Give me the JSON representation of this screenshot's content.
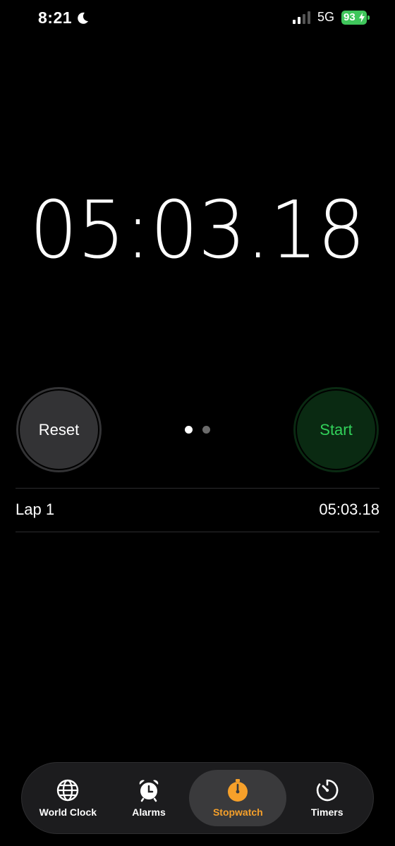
{
  "status_bar": {
    "time": "8:21",
    "network": "5G",
    "battery": "93",
    "battery_color": "#3fc65b"
  },
  "stopwatch": {
    "elapsed": "05:03.18"
  },
  "controls": {
    "reset_label": "Reset",
    "start_label": "Start",
    "start_color": "#32d15a",
    "page_count": 2,
    "active_page": 1
  },
  "laps": [
    {
      "label": "Lap 1",
      "time": "05:03.18"
    }
  ],
  "tab_bar": {
    "tabs": [
      {
        "label": "World Clock",
        "icon": "globe-icon"
      },
      {
        "label": "Alarms",
        "icon": "alarm-clock-icon"
      },
      {
        "label": "Stopwatch",
        "icon": "stopwatch-icon",
        "active": true
      },
      {
        "label": "Timers",
        "icon": "timer-icon"
      }
    ],
    "active_color": "#f6a02a"
  }
}
